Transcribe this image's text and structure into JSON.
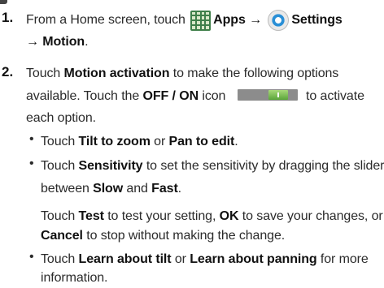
{
  "colors": {
    "apps_icon": "#3f7f4a",
    "settings_icon": "#2a8fd6",
    "toggle_on": "#5aa63a",
    "toggle_track": "#8c8c8c"
  },
  "icons": {
    "apps": "apps-grid-icon",
    "settings": "settings-gear-icon",
    "toggle": "toggle-on-icon"
  },
  "step1": {
    "number": "1.",
    "t1": "From a Home screen, touch ",
    "apps": "Apps",
    "arrow1": " → ",
    "settings": "Settings",
    "arrow2": "→ ",
    "motion": "Motion",
    "end": "."
  },
  "step2": {
    "number": "2.",
    "t1": "Touch ",
    "motion_activation": "Motion activation",
    "t2": " to make the following options",
    "t3": "available. Touch the ",
    "off_on": "OFF / ON",
    "t4": " icon ",
    "t5": " to activate",
    "t6": "each option."
  },
  "bullets": {
    "b1": {
      "t1": "Touch ",
      "tilt": "Tilt to zoom",
      "or": " or ",
      "pan": "Pan to edit",
      "end": "."
    },
    "b2": {
      "t1": "Touch ",
      "sensitivity": "Sensitivity",
      "t2": " to set the sensitivity by dragging the slider",
      "t3": "between ",
      "slow": "Slow",
      "and": " and ",
      "fast": "Fast",
      "end": "."
    },
    "sub": {
      "t1": "Touch ",
      "test": "Test",
      "t2": " to test your setting, ",
      "ok": "OK",
      "t3": " to save your changes, or",
      "cancel": "Cancel",
      "t4": " to stop without making the change."
    },
    "b3": {
      "t1": "Touch ",
      "learn_tilt": "Learn about tilt",
      "or": " or ",
      "learn_pan": "Learn about panning",
      "t2": " for more",
      "t3": "information."
    },
    "dot": "•"
  }
}
